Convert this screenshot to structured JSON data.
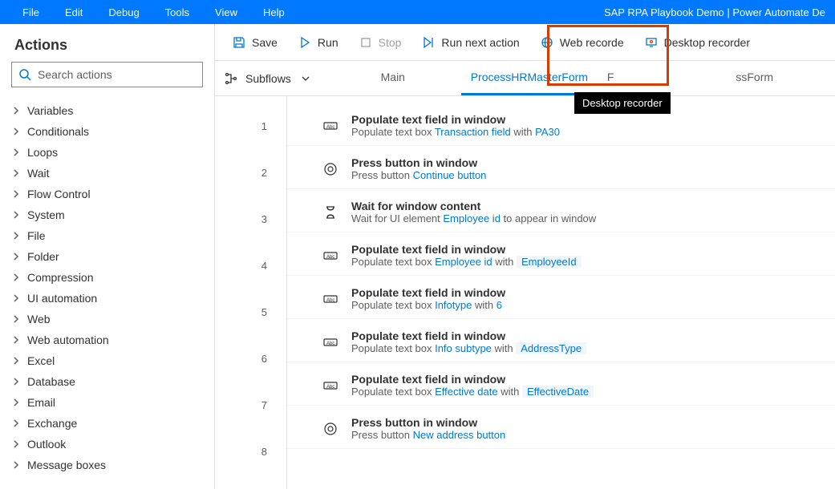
{
  "menubar": {
    "items": [
      "File",
      "Edit",
      "Debug",
      "Tools",
      "View",
      "Help"
    ],
    "title": "SAP RPA Playbook Demo | Power Automate De"
  },
  "toolbar": {
    "save": "Save",
    "run": "Run",
    "stop": "Stop",
    "run_next": "Run next action",
    "web_recorder": "Web recorde",
    "desktop_recorder": "Desktop recorder"
  },
  "tooltip_text": "Desktop recorder",
  "sidebar": {
    "title": "Actions",
    "search_placeholder": "Search actions",
    "items": [
      "Variables",
      "Conditionals",
      "Loops",
      "Wait",
      "Flow Control",
      "System",
      "File",
      "Folder",
      "Compression",
      "UI automation",
      "Web",
      "Web automation",
      "Excel",
      "Database",
      "Email",
      "Exchange",
      "Outlook",
      "Message boxes"
    ]
  },
  "tabs": {
    "subflows_label": "Subflows",
    "items": [
      "Main",
      "ProcessHRMasterForm",
      "F"
    ],
    "suffix": "ssForm",
    "active_index": 1
  },
  "steps": [
    {
      "icon": "textfield",
      "title": "Populate text field in window",
      "desc_prefix": "Populate text box ",
      "link": "Transaction field",
      "mid": " with ",
      "val": "PA30",
      "val_chip": false
    },
    {
      "icon": "button",
      "title": "Press button in window",
      "desc_prefix": "Press button ",
      "link": "Continue button",
      "mid": "",
      "val": "",
      "val_chip": false
    },
    {
      "icon": "wait",
      "title": "Wait for window content",
      "desc_prefix": "Wait for UI element ",
      "link": "Employee id",
      "mid": " to appear in window",
      "val": "",
      "val_chip": false
    },
    {
      "icon": "textfield",
      "title": "Populate text field in window",
      "desc_prefix": "Populate text box ",
      "link": "Employee id",
      "mid": " with ",
      "val": "EmployeeId",
      "val_chip": true
    },
    {
      "icon": "textfield",
      "title": "Populate text field in window",
      "desc_prefix": "Populate text box ",
      "link": "Infotype",
      "mid": " with ",
      "val": "6",
      "val_chip": false
    },
    {
      "icon": "textfield",
      "title": "Populate text field in window",
      "desc_prefix": "Populate text box ",
      "link": "Info subtype",
      "mid": " with ",
      "val": "AddressType",
      "val_chip": true
    },
    {
      "icon": "textfield",
      "title": "Populate text field in window",
      "desc_prefix": "Populate text box ",
      "link": "Effective date",
      "mid": " with ",
      "val": "EffectiveDate",
      "val_chip": true
    },
    {
      "icon": "button",
      "title": "Press button in window",
      "desc_prefix": "Press button ",
      "link": "New address button",
      "mid": "",
      "val": "",
      "val_chip": false
    }
  ]
}
